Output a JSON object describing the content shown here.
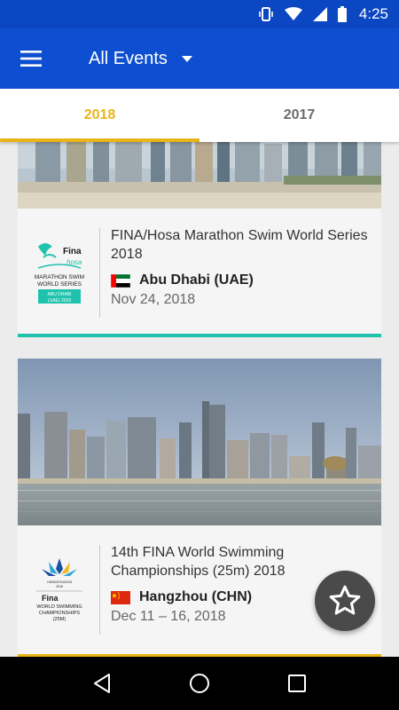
{
  "status_bar": {
    "time": "4:25",
    "icons": [
      "vibrate-icon",
      "wifi-icon",
      "signal-icon",
      "battery-icon"
    ]
  },
  "app_bar": {
    "title": "All Events",
    "menu_icon": "hamburger-menu-icon",
    "dropdown_icon": "dropdown-arrow-icon",
    "color": "#0d4fd0"
  },
  "tabs": [
    {
      "label": "2018",
      "active": true
    },
    {
      "label": "2017",
      "active": false
    }
  ],
  "events": [
    {
      "title": "FINA/Hosa Marathon Swim World Series 2018",
      "location": "Abu Dhabi (UAE)",
      "date": "Nov 24, 2018",
      "flag": "uae-flag-icon",
      "accent_color": "#1fc3ad",
      "logo": {
        "brand": "Fina",
        "sub": "hosa",
        "line1": "MARATHON SWIM",
        "line2": "WORLD SERIES",
        "line3": "ABU DHABI",
        "line4": "(UAE) 2018"
      }
    },
    {
      "title": "14th FINA World Swimming Championships (25m) 2018",
      "location": "Hangzhou (CHN)",
      "date": "Dec 11 – 16, 2018",
      "flag": "china-flag-icon",
      "accent_color": "#e8b418",
      "logo": {
        "top": "HANGZHOU2018",
        "sub": "2018",
        "brand": "Fina",
        "line1": "WORLD SWIMMING",
        "line2": "CHAMPIONSHIPS",
        "line3": "(25M)"
      }
    }
  ],
  "fab": {
    "icon": "star-icon"
  },
  "nav_bar": {
    "icons": [
      "back-icon",
      "home-icon",
      "recents-icon"
    ]
  }
}
